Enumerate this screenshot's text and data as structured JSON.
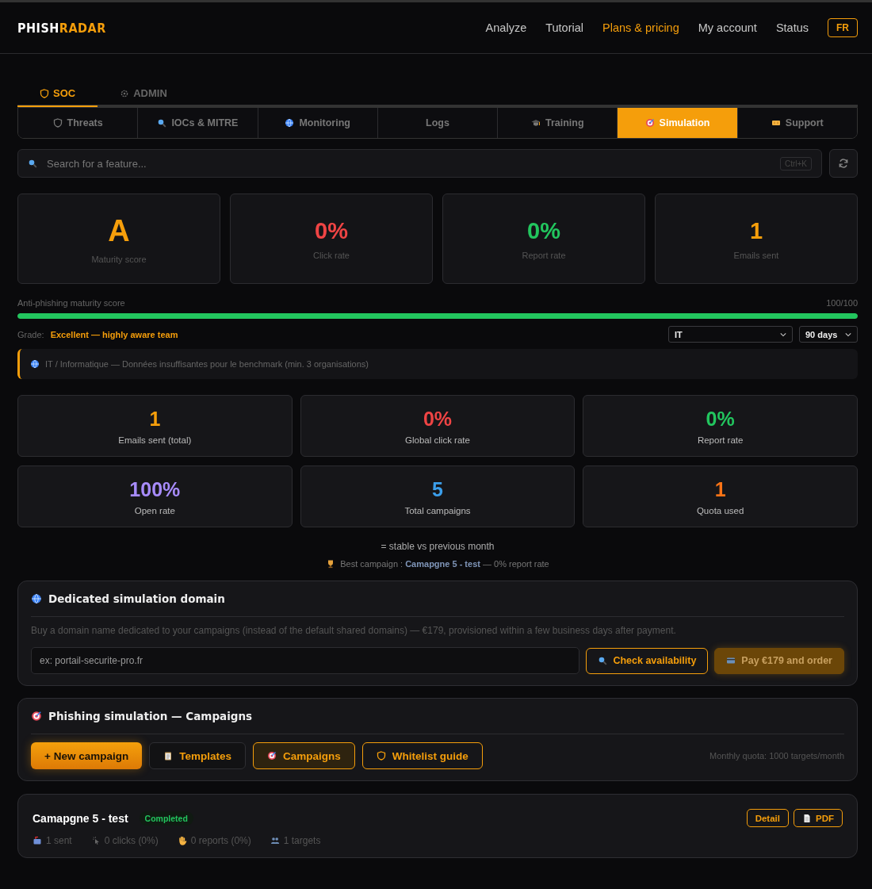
{
  "header": {
    "logo_first": "PHISH",
    "logo_second": "RADAR",
    "nav": [
      {
        "label": "Analyze",
        "selected": false
      },
      {
        "label": "Tutorial",
        "selected": false
      },
      {
        "label": "Plans & pricing",
        "selected": true
      },
      {
        "label": "My account",
        "selected": false
      },
      {
        "label": "Status",
        "selected": false
      }
    ],
    "language": "FR"
  },
  "sections": [
    {
      "label": "SOC",
      "selected": true
    },
    {
      "label": "ADMIN",
      "selected": false
    }
  ],
  "tabs": [
    {
      "label": "Threats",
      "selected": false
    },
    {
      "label": "IOCs & MITRE",
      "selected": false
    },
    {
      "label": "Monitoring",
      "selected": false
    },
    {
      "label": "Logs",
      "selected": false
    },
    {
      "label": "Training",
      "selected": false
    },
    {
      "label": "Simulation",
      "selected": true
    },
    {
      "label": "Support",
      "selected": false
    }
  ],
  "search": {
    "placeholder": "Search for a feature...",
    "shortcut": "Ctrl+K"
  },
  "score_cards": [
    {
      "value": "A",
      "label": "Maturity score",
      "color": "#f59e0b"
    },
    {
      "value": "0%",
      "label": "Click rate",
      "color": "#ef4444"
    },
    {
      "value": "0%",
      "label": "Report rate",
      "color": "#22c55e"
    },
    {
      "value": "1",
      "label": "Emails sent",
      "color": "#f59e0b"
    }
  ],
  "maturity": {
    "label": "Anti-phishing maturity score",
    "reading": "100/100",
    "level": 1,
    "grade_label": "Grade:",
    "grade": "Excellent — highly aware team"
  },
  "filters": [
    {
      "value": "IT"
    },
    {
      "value": "90 days"
    }
  ],
  "benchmark_note": "IT / Informatique — Données insuffisantes pour le benchmark (min. 3 organisations)",
  "stats": [
    {
      "value": "1",
      "label": "Emails sent (total)",
      "color": "#f59e0b"
    },
    {
      "value": "0%",
      "label": "Global click rate",
      "color": "#ef4444"
    },
    {
      "value": "0%",
      "label": "Report rate",
      "color": "#22c55e"
    },
    {
      "value": "100%",
      "label": "Open rate",
      "color": "#a78bfa"
    },
    {
      "value": "5",
      "label": "Total campaigns",
      "color": "#3b9eea"
    },
    {
      "value": "1",
      "label": "Quota used",
      "color": "#f97316"
    }
  ],
  "trend": "= stable vs previous month",
  "best_campaign": "Best campaign : **Camapgne 5 - test** — 0% report rate",
  "domain_panel": {
    "title": "Dedicated simulation domain",
    "description": "Buy a domain name dedicated to your campaigns (instead of the default shared domains) — €179, provisioned within a few business days after payment.",
    "placeholder": "ex: portail-securite-pro.fr",
    "check_button": "Check availability",
    "order_button": "Pay €179 and order"
  },
  "campaigns_panel": {
    "title": "Phishing simulation — Campaigns",
    "buttons": [
      {
        "label": "+ New campaign",
        "kind": "primary"
      },
      {
        "label": "Templates",
        "kind": "plain"
      },
      {
        "label": "Campaigns",
        "kind": "active"
      },
      {
        "label": "Whitelist guide",
        "kind": "outline"
      }
    ],
    "quota": "Monthly quota: 1000 targets/month"
  },
  "campaigns": [
    {
      "name": "Camapgne 5 - test",
      "status": "Completed",
      "actions": [
        "Detail",
        "PDF"
      ],
      "metrics": [
        "1 sent",
        "0 clicks (0%)",
        "0 reports (0%)",
        "1 targets"
      ]
    }
  ]
}
